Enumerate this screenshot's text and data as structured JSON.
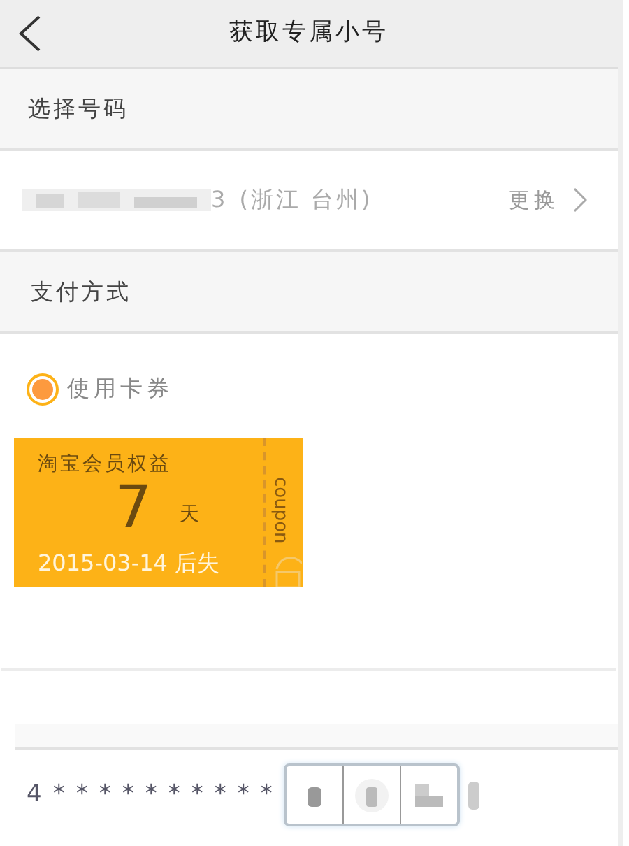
{
  "header": {
    "title": "获取专属小号"
  },
  "number_section": {
    "heading": "选择号码",
    "number_suffix": "3",
    "region": "(浙江 台州)",
    "change_link": "更换"
  },
  "payment_section": {
    "heading": "支付方式",
    "option": {
      "label": "使用卡券",
      "selected": true
    }
  },
  "coupon": {
    "title": "淘宝会员权益",
    "amount": "7",
    "unit": "天",
    "expiry": "2015-03-14 后失",
    "side_label": "coupon"
  },
  "bottom": {
    "masked_number": "4**********"
  }
}
